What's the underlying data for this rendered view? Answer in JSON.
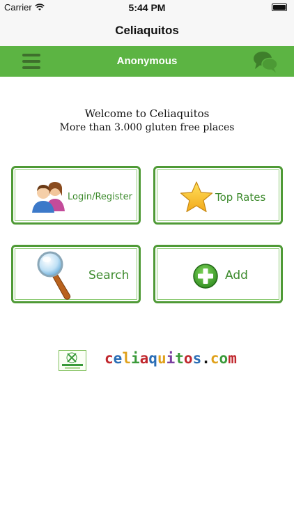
{
  "status_bar": {
    "carrier": "Carrier",
    "time": "5:44 PM"
  },
  "nav_bar": {
    "title": "Celiaquitos"
  },
  "green_bar": {
    "user_name": "Anonymous"
  },
  "welcome": {
    "line1": "Welcome to Celiaquitos",
    "line2": "More than 3.000 gluten free places"
  },
  "tiles": {
    "login": {
      "label": "Login/Register",
      "icon": "users-icon"
    },
    "top_rates": {
      "label": "Top Rates",
      "icon": "star-icon"
    },
    "search": {
      "label": "Search",
      "icon": "magnifier-icon"
    },
    "add": {
      "label": "Add",
      "icon": "plus-circle-icon"
    }
  },
  "footer": {
    "logo_text": "celiaquitos.com",
    "domain_letters": [
      "c",
      "e",
      "l",
      "i",
      "a",
      "q",
      "u",
      "i",
      "t",
      "o",
      "s",
      ".",
      "c",
      "o",
      "m"
    ],
    "domain_colors": [
      "#c0272d",
      "#2a6db5",
      "#e0a11b",
      "#3a9a3a",
      "#c0272d",
      "#2a6db5",
      "#e0a11b",
      "#7a3fa0",
      "#3a9a3a",
      "#c0272d",
      "#2a6db5",
      "#111111",
      "#e0a11b",
      "#3a9a3a",
      "#c0272d"
    ]
  },
  "colors": {
    "brand_green": "#5cb443",
    "tile_border": "#4f9a36",
    "tile_text": "#3c8a2c"
  }
}
